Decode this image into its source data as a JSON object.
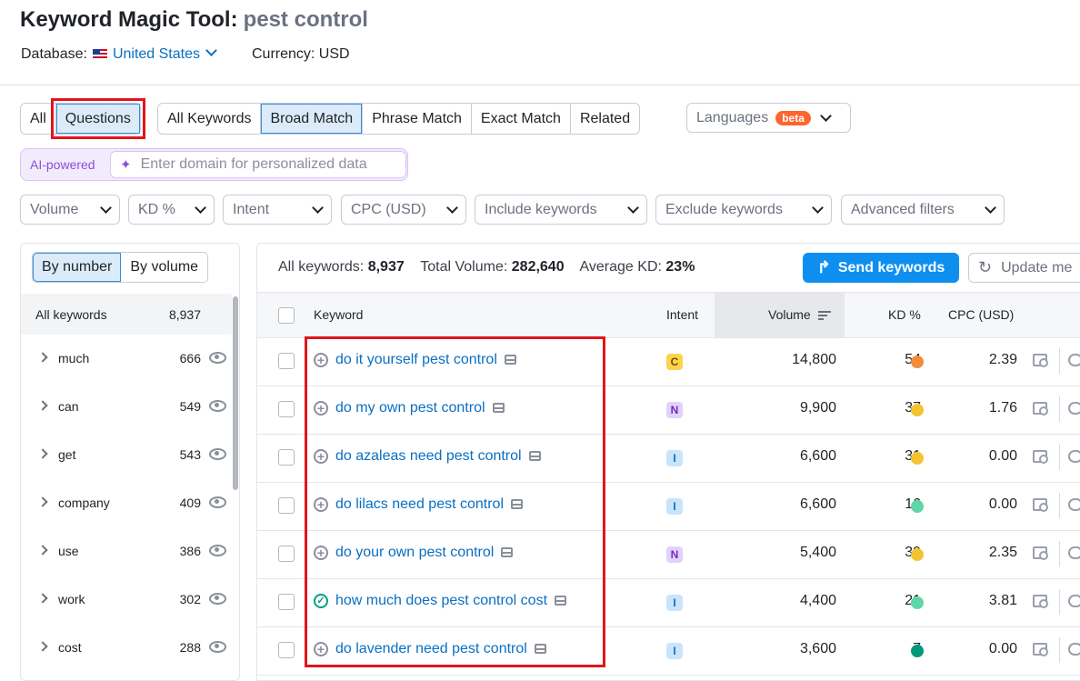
{
  "header": {
    "title": "Keyword Magic Tool:",
    "query": "pest control",
    "database_label": "Database:",
    "database_value": "United States",
    "currency": "Currency: USD"
  },
  "tabs": {
    "scope": [
      "All",
      "Questions"
    ],
    "match": [
      "All Keywords",
      "Broad Match",
      "Phrase Match",
      "Exact Match",
      "Related"
    ],
    "languages_label": "Languages",
    "beta": "beta"
  },
  "ai": {
    "label": "AI-powered",
    "placeholder": "Enter domain for personalized data"
  },
  "filters": [
    "Volume",
    "KD %",
    "Intent",
    "CPC (USD)",
    "Include keywords",
    "Exclude keywords",
    "Advanced filters"
  ],
  "left_panel": {
    "toggle": [
      "By number",
      "By volume"
    ],
    "all_label": "All keywords",
    "all_count": "8,937",
    "groups": [
      {
        "word": "much",
        "count": "666"
      },
      {
        "word": "can",
        "count": "549"
      },
      {
        "word": "get",
        "count": "543"
      },
      {
        "word": "company",
        "count": "409"
      },
      {
        "word": "use",
        "count": "386"
      },
      {
        "word": "work",
        "count": "302"
      },
      {
        "word": "cost",
        "count": "288"
      }
    ]
  },
  "stats": {
    "all_label": "All keywords:",
    "all_value": "8,937",
    "volume_label": "Total Volume:",
    "volume_value": "282,640",
    "kd_label": "Average KD:",
    "kd_value": "23%"
  },
  "buttons": {
    "send": "Send keywords",
    "update": "Update me"
  },
  "table": {
    "columns": [
      "Keyword",
      "Intent",
      "Volume",
      "KD %",
      "CPC (USD)"
    ],
    "rows": [
      {
        "keyword": "do it yourself pest control",
        "intent": "C",
        "volume": "14,800",
        "kd": "54",
        "kd_color": "#f58b3c",
        "cpc": "2.39",
        "added": false
      },
      {
        "keyword": "do my own pest control",
        "intent": "N",
        "volume": "9,900",
        "kd": "37",
        "kd_color": "#f5c330",
        "cpc": "1.76",
        "added": false
      },
      {
        "keyword": "do azaleas need pest control",
        "intent": "I",
        "volume": "6,600",
        "kd": "31",
        "kd_color": "#f5c330",
        "cpc": "0.00",
        "added": false
      },
      {
        "keyword": "do lilacs need pest control",
        "intent": "I",
        "volume": "6,600",
        "kd": "16",
        "kd_color": "#5fd6a8",
        "cpc": "0.00",
        "added": false
      },
      {
        "keyword": "do your own pest control",
        "intent": "N",
        "volume": "5,400",
        "kd": "39",
        "kd_color": "#f5c330",
        "cpc": "2.35",
        "added": false
      },
      {
        "keyword": "how much does pest control cost",
        "intent": "I",
        "volume": "4,400",
        "kd": "21",
        "kd_color": "#5fd6a8",
        "cpc": "3.81",
        "added": true
      },
      {
        "keyword": "do lavender need pest control",
        "intent": "I",
        "volume": "3,600",
        "kd": "7",
        "kd_color": "#00997a",
        "cpc": "0.00",
        "added": false
      }
    ]
  },
  "colors": {
    "accent": "#0e8ff0",
    "link": "#0a6fc2",
    "highlight": "#e3141b"
  }
}
